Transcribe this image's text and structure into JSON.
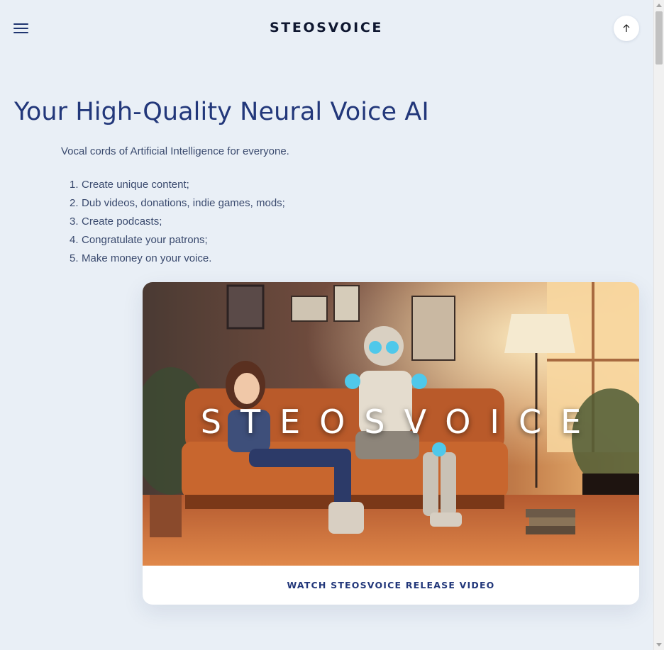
{
  "header": {
    "logo": "STEOSVOICE",
    "menu_icon": "hamburger-menu-icon",
    "top_icon": "arrow-up-icon"
  },
  "hero": {
    "title": "Your High-Quality Neural Voice AI",
    "subtitle": "Vocal cords of Artificial Intelligence for everyone.",
    "features": [
      {
        "num": "1.",
        "text": "Create unique content;"
      },
      {
        "num": "2.",
        "text": "Dub videos, donations, indie games, mods;"
      },
      {
        "num": "3.",
        "text": "Create podcasts;"
      },
      {
        "num": "4.",
        "text": "Congratulate your patrons;"
      },
      {
        "num": "5.",
        "text": "Make money on your voice."
      }
    ]
  },
  "video": {
    "overlay_text": "STEOSVOICE",
    "cta": "WATCH STEOSVOICE RELEASE VIDEO"
  },
  "colors": {
    "page_bg": "#e9eff6",
    "heading": "#22377a",
    "body_text": "#3a4a6e"
  }
}
